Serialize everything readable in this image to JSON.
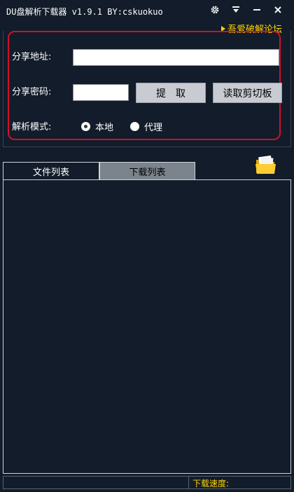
{
  "window": {
    "title": "DU盘解析下载器 v1.9.1 BY:cskuokuo",
    "controls": [
      "settings-icon",
      "dropdown-icon",
      "minimize-icon",
      "close-icon"
    ]
  },
  "forum_link": "吾爱破解论坛",
  "form": {
    "share_url_label": "分享地址:",
    "share_url_value": "",
    "share_pwd_label": "分享密码:",
    "share_pwd_value": "",
    "extract_button": "提　取",
    "read_clipboard_button": "读取剪切板",
    "mode_label": "解析模式:",
    "mode_options": [
      {
        "label": "本地",
        "selected": true
      },
      {
        "label": "代理",
        "selected": false
      }
    ]
  },
  "tabs": [
    {
      "label": "文件列表",
      "active": true
    },
    {
      "label": "下载列表",
      "active": false
    }
  ],
  "status": {
    "left": "",
    "speed_label": "下载速度:"
  },
  "colors": {
    "background": "#121c2a",
    "accent_red": "#d0112b",
    "link_yellow": "#ffd500"
  }
}
